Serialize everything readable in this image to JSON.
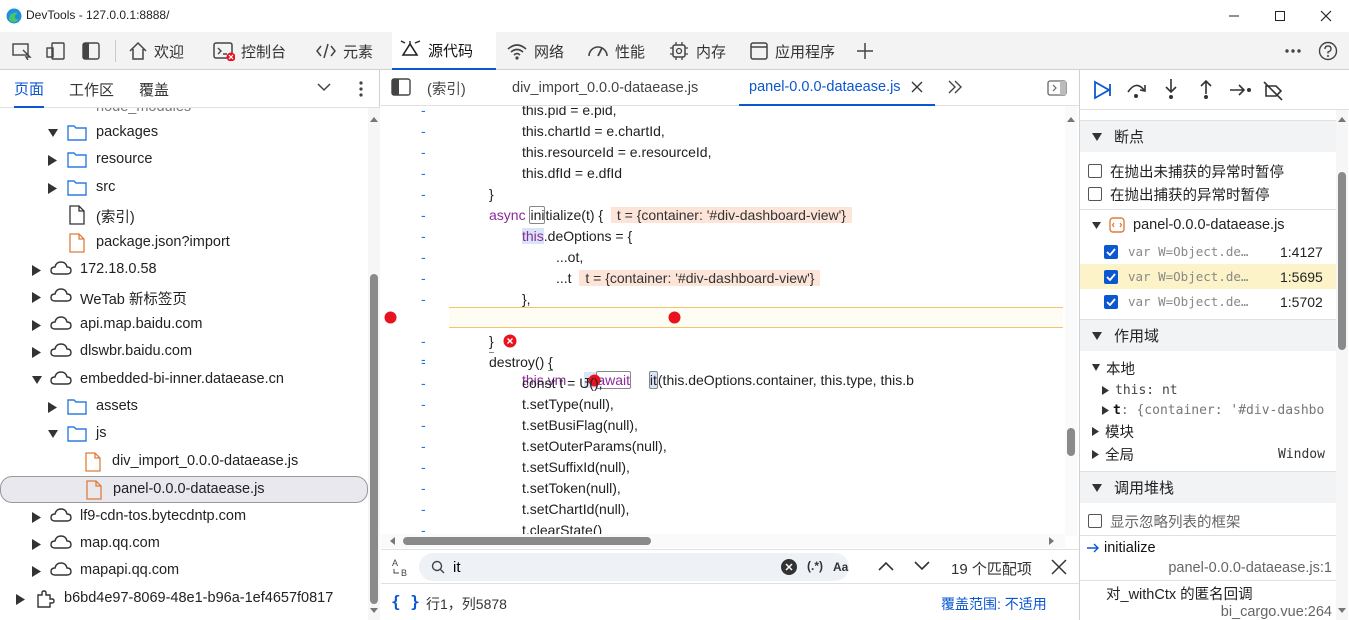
{
  "window": {
    "title": "DevTools - 127.0.0.1:8888/"
  },
  "panel_tabs": [
    {
      "label": "欢迎"
    },
    {
      "label": "控制台"
    },
    {
      "label": "元素"
    },
    {
      "label": "源代码"
    },
    {
      "label": "网络"
    },
    {
      "label": "性能"
    },
    {
      "label": "内存"
    },
    {
      "label": "应用程序"
    }
  ],
  "navigator": {
    "tabs": [
      "页面",
      "工作区",
      "覆盖"
    ],
    "partial_top": "node_modules",
    "tree": [
      {
        "label": "packages",
        "icon": "folder-icon"
      },
      {
        "label": "resource",
        "icon": "folder-icon"
      },
      {
        "label": "src",
        "icon": "folder-icon"
      },
      {
        "label": "(索引)",
        "icon": "file-icon"
      },
      {
        "label": "package.json?import",
        "icon": "file-icon"
      },
      {
        "label": "172.18.0.58",
        "icon": "cloud-icon"
      },
      {
        "label": "WeTab 新标签页",
        "icon": "cloud-icon"
      },
      {
        "label": "api.map.baidu.com",
        "icon": "cloud-icon"
      },
      {
        "label": "dlswbr.baidu.com",
        "icon": "cloud-icon"
      },
      {
        "label": "embedded-bi-inner.dataease.cn",
        "icon": "cloud-icon"
      },
      {
        "label": "assets",
        "icon": "folder-icon"
      },
      {
        "label": "js",
        "icon": "folder-icon"
      },
      {
        "label": "div_import_0.0.0-dataease.js",
        "icon": "file-icon"
      },
      {
        "label": "panel-0.0.0-dataease.js",
        "icon": "file-icon"
      },
      {
        "label": "lf9-cdn-tos.bytecdntp.com",
        "icon": "cloud-icon"
      },
      {
        "label": "map.qq.com",
        "icon": "cloud-icon"
      },
      {
        "label": "mapapi.qq.com",
        "icon": "cloud-icon"
      },
      {
        "label": "b6bd4e97-8069-48e1-b96a-1ef4657f0817",
        "icon": "extension-icon"
      }
    ]
  },
  "editor": {
    "tabs": [
      "(索引)",
      "div_import_0.0.0-dataease.js",
      "panel-0.0.0-dataease.js"
    ],
    "gutter_mark": "-",
    "lines": {
      "l1": "this.pid = e.pid,",
      "l2": "this.chartId = e.chartId,",
      "l3": "this.resourceId = e.resourceId,",
      "l4": "this.dfId = e.dfId",
      "l5": "}",
      "l6a": "async ",
      "l6b": "ini",
      "l6c": "tialize",
      "l6d": "(t) {",
      "l6hint": "t = {container: '#div-dashboard-view'}",
      "l7a": "this",
      "l7b": ".deOptions = {",
      "l8": "...ot,",
      "l9a": "...t",
      "l9hint": "t = {container: '#div-dashboard-view'}",
      "l10": "},",
      "l11a": "this.vm ",
      "l11b": "= ",
      "l11c": "await",
      "l11d": "it",
      "l11e": "(this.deOptions.container, this.type, this.b",
      "l12": "}",
      "l13a": "destroy() ",
      "l13b": "{",
      "l14": "const t = U();",
      "l15": "t.setType(null),",
      "l16": "t.setBusiFlag(null),",
      "l17": "t.setOuterParams(null),",
      "l18": "t.setSuffixId(null),",
      "l19": "t.setToken(null),",
      "l20": "t.setChartId(null),",
      "l21": "t.clearState()"
    }
  },
  "search": {
    "query": "it",
    "regex_label": "(.*)",
    "case_label": "Aa",
    "matches": "19 个匹配项"
  },
  "status": {
    "position": "行1，列5878",
    "coverage": "覆盖范围: 不适用",
    "braces": "{ }"
  },
  "debugger": {
    "breakpoints_title": "断点",
    "pause_uncaught": "在抛出未捕获的异常时暂停",
    "pause_caught": "在抛出捕获的异常时暂停",
    "bp_file": "panel-0.0.0-dataease.js",
    "bps": [
      {
        "code": "var W=Object.de…",
        "loc": "1:4127"
      },
      {
        "code": "var W=Object.de…",
        "loc": "1:5695"
      },
      {
        "code": "var W=Object.de…",
        "loc": "1:5702"
      }
    ],
    "scope_title": "作用域",
    "scope_local": "本地",
    "scope_this": "this: nt",
    "scope_t_key": "t",
    "scope_t_val": ": {container: '#div-dashbo",
    "scope_module": "模块",
    "scope_global": "全局",
    "scope_global_val": "Window",
    "callstack_title": "调用堆栈",
    "show_ignored": "显示忽略列表的框架",
    "frame1_name": "initialize",
    "frame1_loc": "panel-0.0.0-dataease.js:1",
    "frame2_name": "对_withCtx 的匿名回调",
    "frame2_loc": "bi_cargo.vue:264"
  },
  "colors": {
    "accent": "#0b57d0",
    "breakpoint": "#e8131f",
    "highlight_row": "#fdf3c8",
    "inline_hint": "#fde4d8"
  }
}
